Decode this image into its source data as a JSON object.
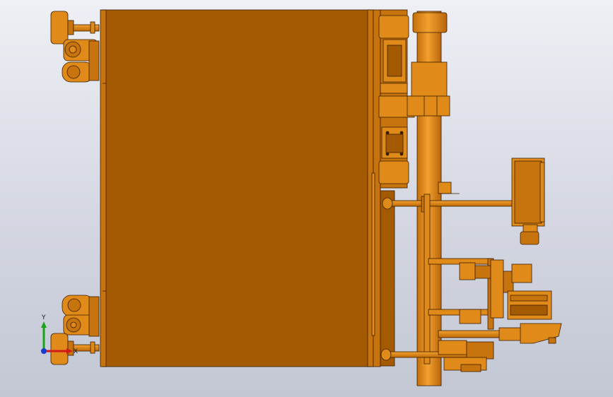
{
  "viewport": {
    "background_top": "#eef0f5",
    "background_bottom": "#c3c7d4"
  },
  "model": {
    "body_color": "#a45a00",
    "part_color": "#e08a1a",
    "part_shade": "#c8740e",
    "edge_color": "#3a1f00"
  },
  "triad": {
    "y_label": "Y",
    "x_label": "X",
    "y_color": "#1aa31a",
    "x_color": "#d01a1a",
    "z_color": "#1a3ad0"
  }
}
